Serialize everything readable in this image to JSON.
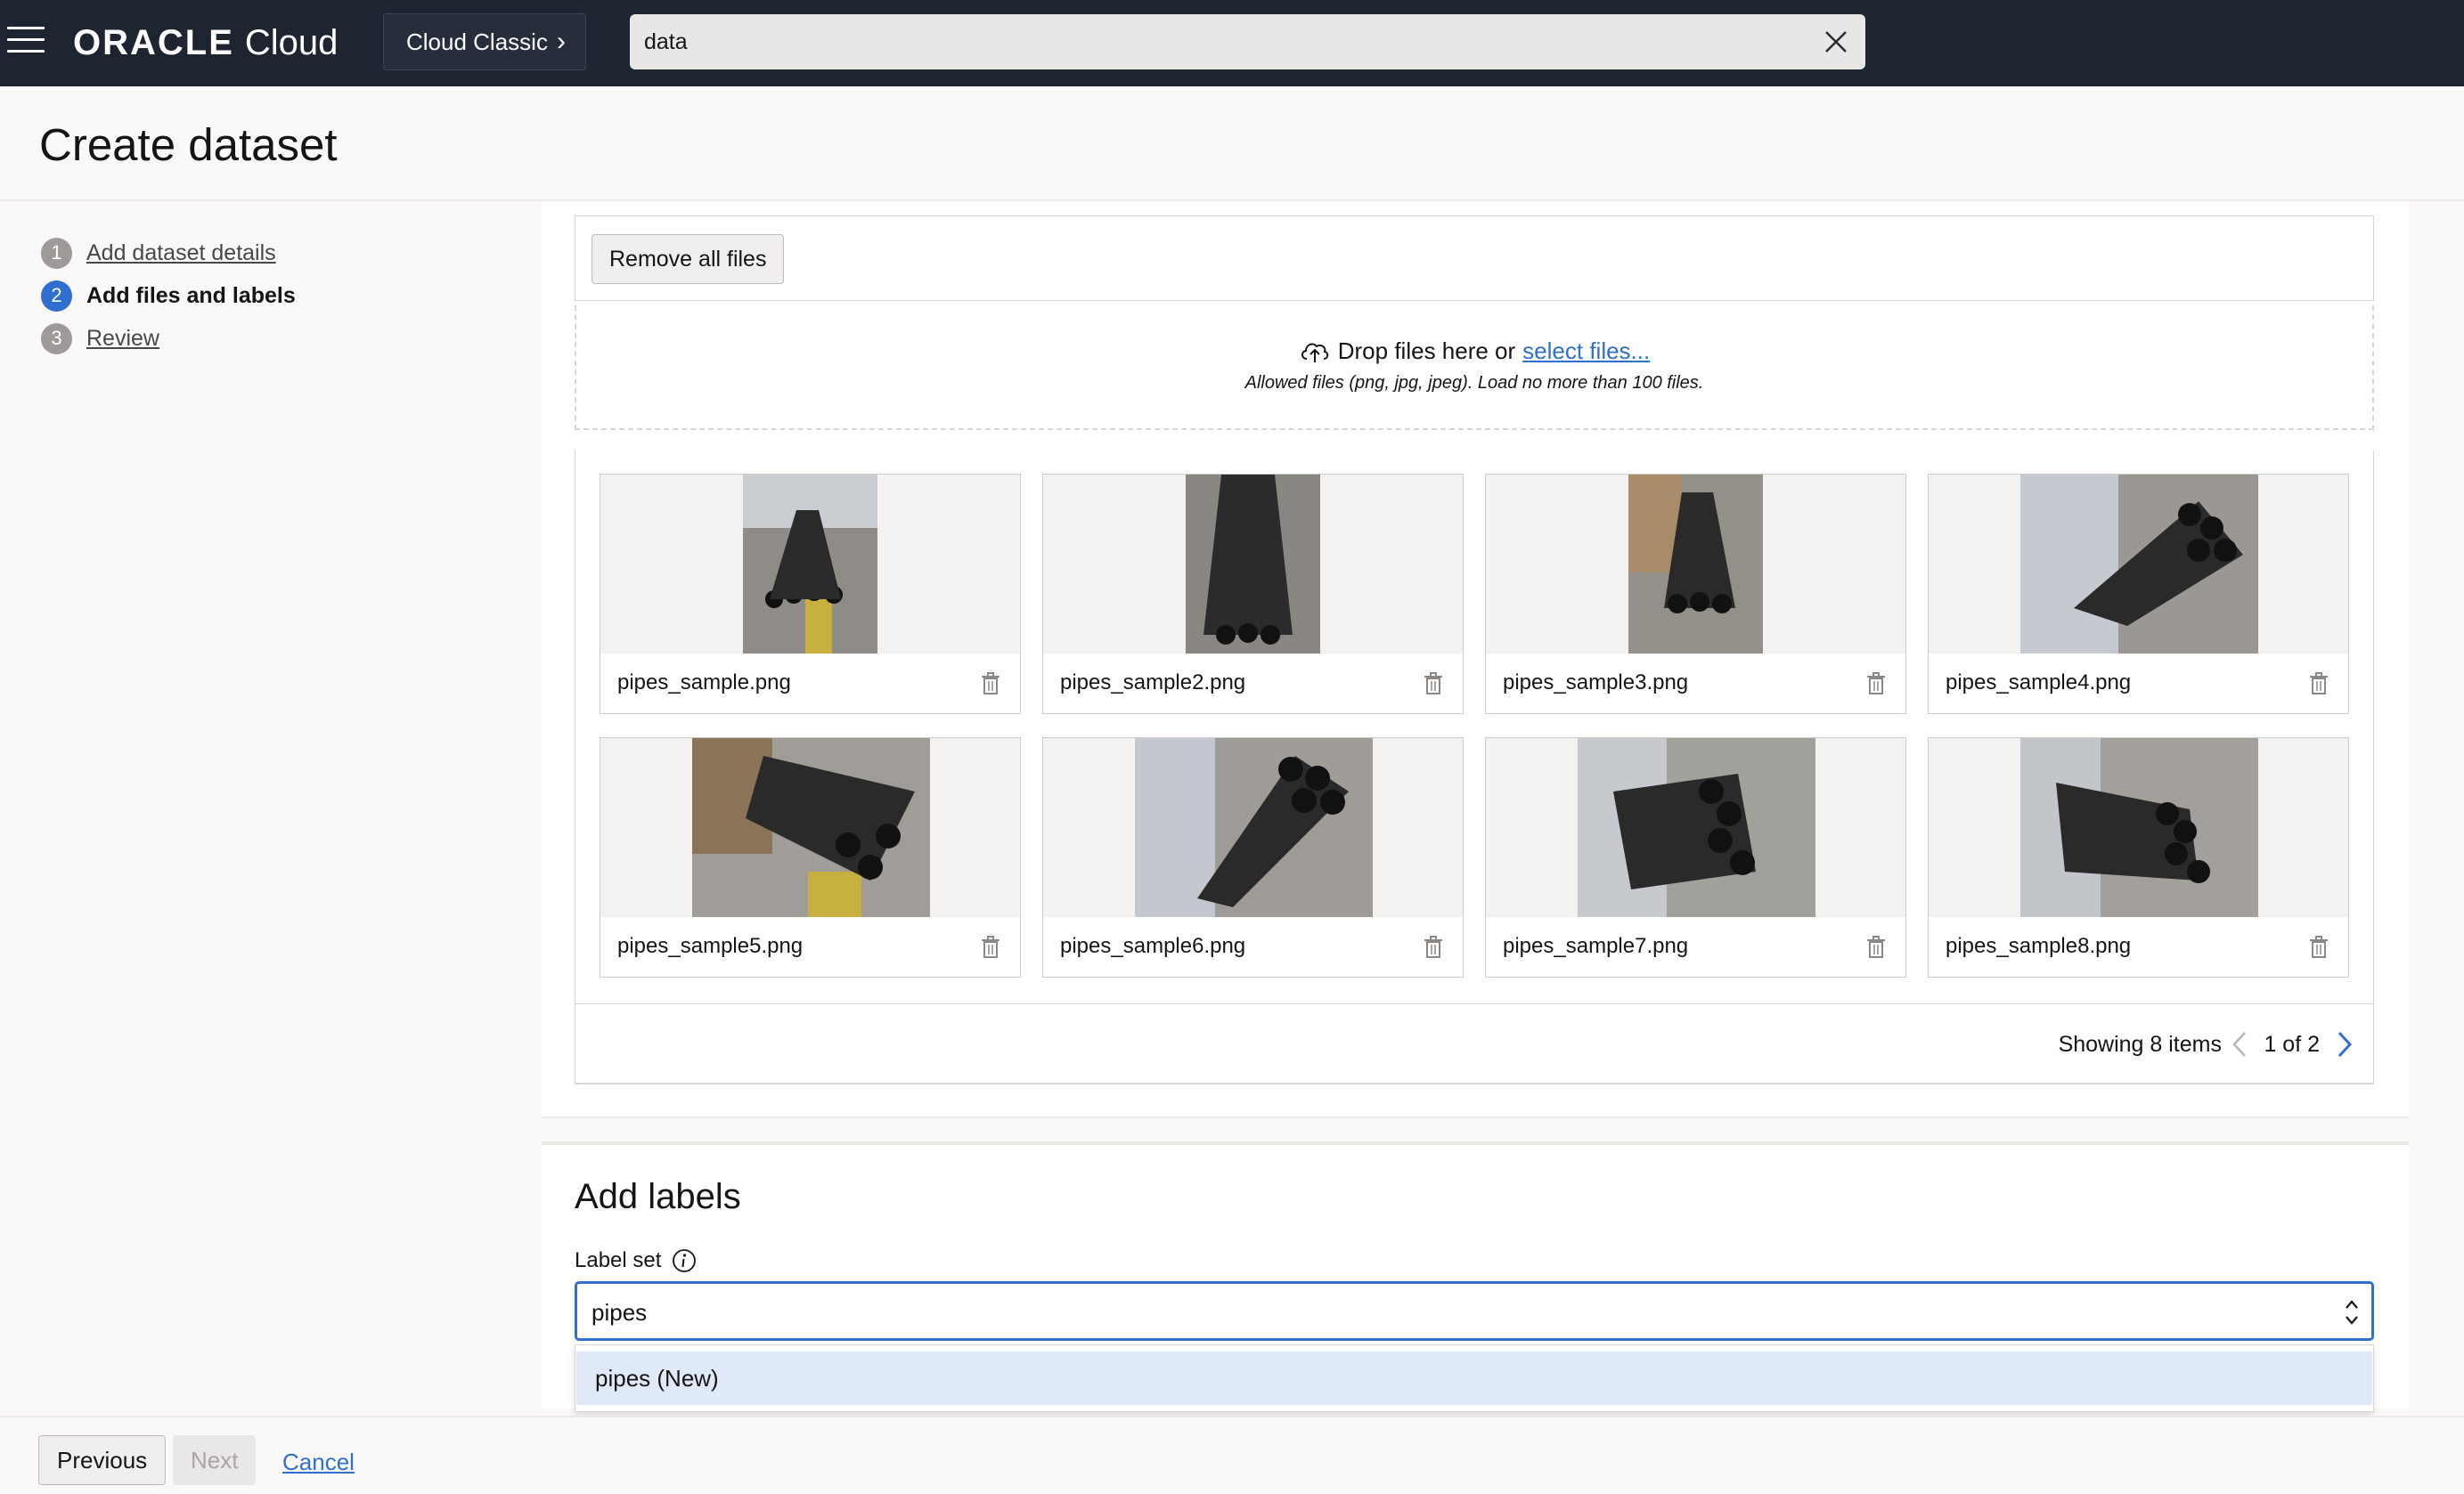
{
  "topbar": {
    "brand_oracle": "ORACLE",
    "brand_cloud": "Cloud",
    "region_button": "Cloud Classic",
    "search_value": "data"
  },
  "page": {
    "title": "Create dataset"
  },
  "steps": [
    {
      "number": "1",
      "label": "Add dataset details",
      "state": "completed"
    },
    {
      "number": "2",
      "label": "Add files and labels",
      "state": "active"
    },
    {
      "number": "3",
      "label": "Review",
      "state": "pending"
    }
  ],
  "files": {
    "remove_all_label": "Remove all files",
    "drop_text": "Drop files here or",
    "select_link": "select files...",
    "allowed_text": "Allowed files (png, jpg, jpeg). Load no more than 100 files.",
    "items": [
      {
        "name": "pipes_sample.png"
      },
      {
        "name": "pipes_sample2.png"
      },
      {
        "name": "pipes_sample3.png"
      },
      {
        "name": "pipes_sample4.png"
      },
      {
        "name": "pipes_sample5.png"
      },
      {
        "name": "pipes_sample6.png"
      },
      {
        "name": "pipes_sample7.png"
      },
      {
        "name": "pipes_sample8.png"
      }
    ],
    "showing": "Showing 8 items",
    "page_text": "1 of 2"
  },
  "labels": {
    "title": "Add labels",
    "label_set_label": "Label set",
    "label_set_value": "pipes",
    "option": "pipes (New)"
  },
  "footer": {
    "previous": "Previous",
    "next": "Next",
    "cancel": "Cancel"
  },
  "colors": {
    "accent": "#2e6fcf",
    "topbar": "#1d2530",
    "option_highlight": "#dfe9f7"
  }
}
